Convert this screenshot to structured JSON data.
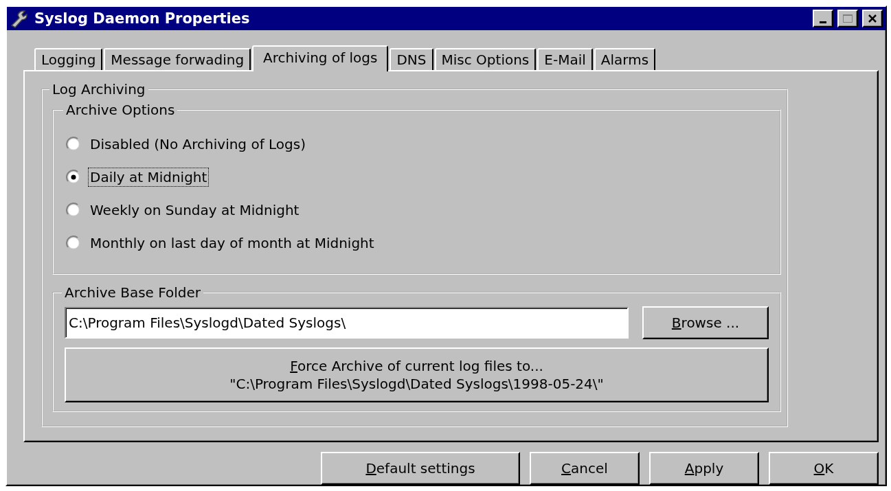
{
  "window": {
    "title": "Syslog Daemon Properties"
  },
  "tabs": [
    {
      "label": "Logging",
      "selected": false
    },
    {
      "label": "Message forwading",
      "selected": false
    },
    {
      "label": "Archiving of logs",
      "selected": true
    },
    {
      "label": "DNS",
      "selected": false
    },
    {
      "label": "Misc Options",
      "selected": false
    },
    {
      "label": "E-Mail",
      "selected": false
    },
    {
      "label": "Alarms",
      "selected": false
    }
  ],
  "log_archiving": {
    "title": "Log Archiving",
    "archive_options": {
      "title": "Archive Options",
      "options": [
        {
          "label": "Disabled (No Archiving of Logs)",
          "selected": false,
          "focused": false
        },
        {
          "label": "Daily at Midnight",
          "selected": true,
          "focused": true
        },
        {
          "label": "Weekly on Sunday at Midnight",
          "selected": false,
          "focused": false
        },
        {
          "label": "Monthly on last day of month at Midnight",
          "selected": false,
          "focused": false
        }
      ]
    },
    "archive_base_folder": {
      "title": "Archive Base Folder",
      "value": "C:\\Program Files\\Syslogd\\Dated Syslogs\\",
      "browse_button": {
        "label": "Browse ...",
        "underline_first": true
      },
      "force_button": {
        "lines": [
          "Force Archive of current log files to...",
          "\"C:\\Program Files\\Syslogd\\Dated Syslogs\\1998-05-24\\\""
        ],
        "underline_first": true
      }
    }
  },
  "buttons": [
    {
      "label": "Default settings",
      "underline_first": true
    },
    {
      "label": "Cancel",
      "underline_first": true
    },
    {
      "label": "Apply",
      "underline_first": true
    },
    {
      "label": "OK",
      "underline_first": true
    }
  ]
}
